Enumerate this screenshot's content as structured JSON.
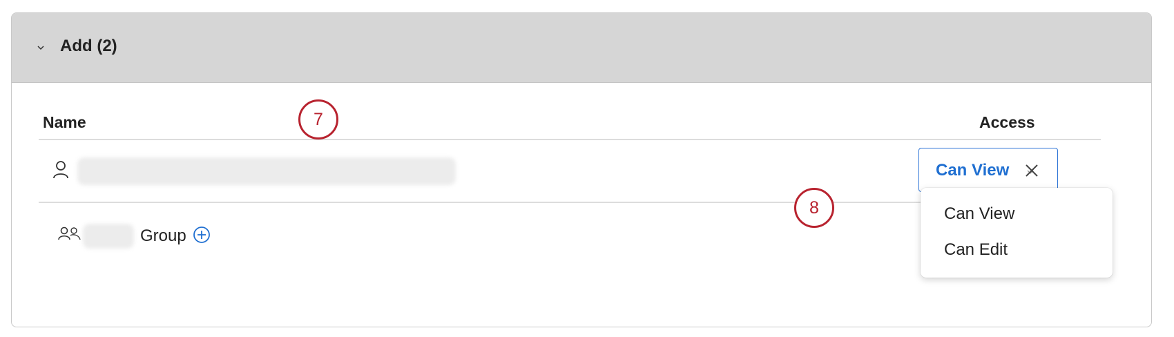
{
  "panel": {
    "title": "Add (2)",
    "expanded": true,
    "header_color": "#d6d6d6"
  },
  "table": {
    "headers": {
      "name": "Name",
      "access": "Access"
    },
    "rows": [
      {
        "type": "user",
        "icon": "person-icon",
        "name_redacted": true,
        "access": "Can View"
      },
      {
        "type": "group",
        "icon": "group-icon",
        "name_redacted": true,
        "label": "Group",
        "expand_icon": "plus-circle-icon"
      }
    ]
  },
  "access_dropdown": {
    "selected": "Can View",
    "options": [
      "Can View",
      "Can Edit"
    ],
    "accent_color": "#1f6fd1"
  },
  "callouts": [
    "7",
    "8"
  ],
  "callout_color": "#b8232f"
}
